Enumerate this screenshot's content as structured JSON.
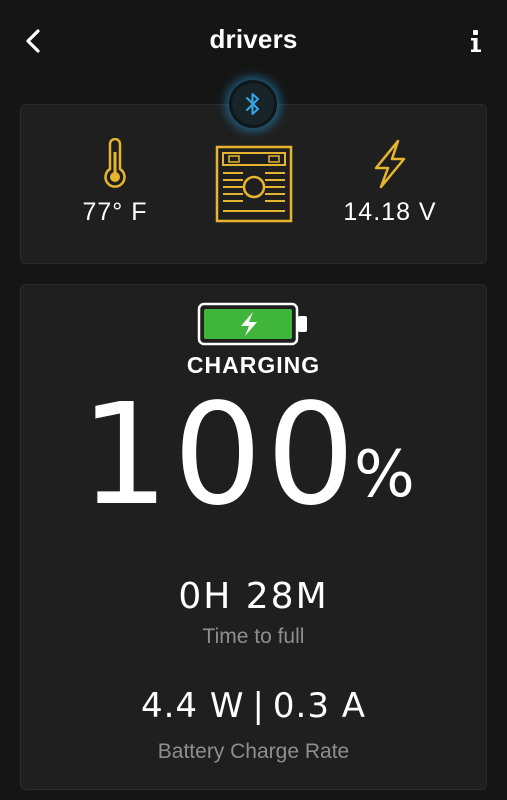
{
  "header": {
    "title": "drivers",
    "back_icon": "chevron-left-icon",
    "info_icon": "info-icon"
  },
  "status": {
    "bluetooth_icon": "bluetooth-icon",
    "temperature": "77° F",
    "voltage": "14.18 V"
  },
  "charge": {
    "state": "CHARGING",
    "percent": "100",
    "percent_sign": "%",
    "battery_level": 1.0,
    "time_value": "0H 28M",
    "time_label": "Time to full",
    "watts": "4.4 W",
    "separator": "|",
    "amps": "0.3 A",
    "rate_label": "Battery Charge Rate"
  },
  "colors": {
    "background": "#151515",
    "card": "#1f1f1f",
    "accent_gold": "#e6b52f",
    "battery_green": "#3fb53a",
    "bluetooth_blue": "#35a8e6",
    "muted_text": "#8e8e8e"
  }
}
